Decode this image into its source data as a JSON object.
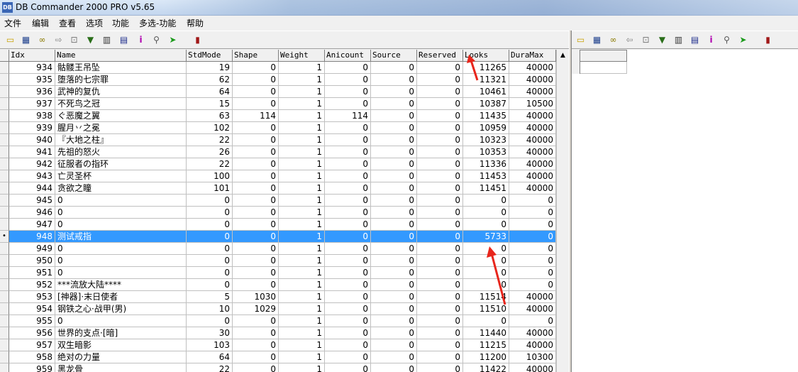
{
  "window": {
    "title": "DB Commander 2000 PRO v5.65",
    "app_icon_text": "DB"
  },
  "menu": [
    "文件",
    "编辑",
    "查看",
    "选项",
    "功能",
    "多选-功能",
    "帮助"
  ],
  "toolbar_icons": [
    "open-folder-icon",
    "grid-icon",
    "binoculars-icon",
    "arrow-icon",
    "filter-icon",
    "trash-icon",
    "column-icon",
    "info-icon",
    "key-search-icon",
    "run-icon",
    "exit-icon"
  ],
  "columns": [
    "Idx",
    "Name",
    "StdMode",
    "Shape",
    "Weight",
    "Anicount",
    "Source",
    "Reserved",
    "Looks",
    "DuraMax"
  ],
  "rows": [
    [
      "934",
      "骷髅王吊坠",
      "19",
      "0",
      "1",
      "0",
      "0",
      "0",
      "11265",
      "40000"
    ],
    [
      "935",
      "堕落的七宗罪",
      "62",
      "0",
      "1",
      "0",
      "0",
      "0",
      "11321",
      "40000"
    ],
    [
      "936",
      "武神的复仇",
      "64",
      "0",
      "1",
      "0",
      "0",
      "0",
      "10461",
      "40000"
    ],
    [
      "937",
      "不死鸟之冠",
      "15",
      "0",
      "1",
      "0",
      "0",
      "0",
      "10387",
      "10500"
    ],
    [
      "938",
      "ぐ恶魔之翼",
      "63",
      "114",
      "1",
      "114",
      "0",
      "0",
      "11435",
      "40000"
    ],
    [
      "939",
      "腥月丷之冕",
      "102",
      "0",
      "1",
      "0",
      "0",
      "0",
      "10959",
      "40000"
    ],
    [
      "940",
      "『大地之柱』",
      "22",
      "0",
      "1",
      "0",
      "0",
      "0",
      "10323",
      "40000"
    ],
    [
      "941",
      "先祖的怒火",
      "26",
      "0",
      "1",
      "0",
      "0",
      "0",
      "10353",
      "40000"
    ],
    [
      "942",
      "征服者の指环",
      "22",
      "0",
      "1",
      "0",
      "0",
      "0",
      "11336",
      "40000"
    ],
    [
      "943",
      "亡灵圣杯",
      "100",
      "0",
      "1",
      "0",
      "0",
      "0",
      "11453",
      "40000"
    ],
    [
      "944",
      "贪欲之瞳",
      "101",
      "0",
      "1",
      "0",
      "0",
      "0",
      "11451",
      "40000"
    ],
    [
      "945",
      "0",
      "0",
      "0",
      "1",
      "0",
      "0",
      "0",
      "0",
      "0"
    ],
    [
      "946",
      "0",
      "0",
      "0",
      "1",
      "0",
      "0",
      "0",
      "0",
      "0"
    ],
    [
      "947",
      "0",
      "0",
      "0",
      "1",
      "0",
      "0",
      "0",
      "0",
      "0"
    ],
    [
      "948",
      "测试戒指",
      "0",
      "0",
      "1",
      "0",
      "0",
      "0",
      "5733",
      "0"
    ],
    [
      "949",
      "0",
      "0",
      "0",
      "1",
      "0",
      "0",
      "0",
      "0",
      "0"
    ],
    [
      "950",
      "0",
      "0",
      "0",
      "1",
      "0",
      "0",
      "0",
      "0",
      "0"
    ],
    [
      "951",
      "0",
      "0",
      "0",
      "1",
      "0",
      "0",
      "0",
      "0",
      "0"
    ],
    [
      "952",
      "***流放大陆****",
      "0",
      "0",
      "1",
      "0",
      "0",
      "0",
      "0",
      "0"
    ],
    [
      "953",
      "[神器]·末日使者",
      "5",
      "1030",
      "1",
      "0",
      "0",
      "0",
      "11514",
      "40000"
    ],
    [
      "954",
      "钢铁之心·战甲(男)",
      "10",
      "1029",
      "1",
      "0",
      "0",
      "0",
      "11510",
      "40000"
    ],
    [
      "955",
      "0",
      "0",
      "0",
      "1",
      "0",
      "0",
      "0",
      "0",
      "0"
    ],
    [
      "956",
      "世界的支点·[暗]",
      "30",
      "0",
      "1",
      "0",
      "0",
      "0",
      "11440",
      "40000"
    ],
    [
      "957",
      "双生暗影",
      "103",
      "0",
      "1",
      "0",
      "0",
      "0",
      "11215",
      "40000"
    ],
    [
      "958",
      "绝对の力量",
      "64",
      "0",
      "1",
      "0",
      "0",
      "0",
      "11200",
      "10300"
    ],
    [
      "959",
      "黑龙骨",
      "22",
      "0",
      "1",
      "0",
      "0",
      "0",
      "11422",
      "40000"
    ]
  ],
  "selected_row_index": 14,
  "row_indicator": "•",
  "colors": {
    "selection": "#3399ff",
    "annotation_arrow": "#e8261c"
  }
}
